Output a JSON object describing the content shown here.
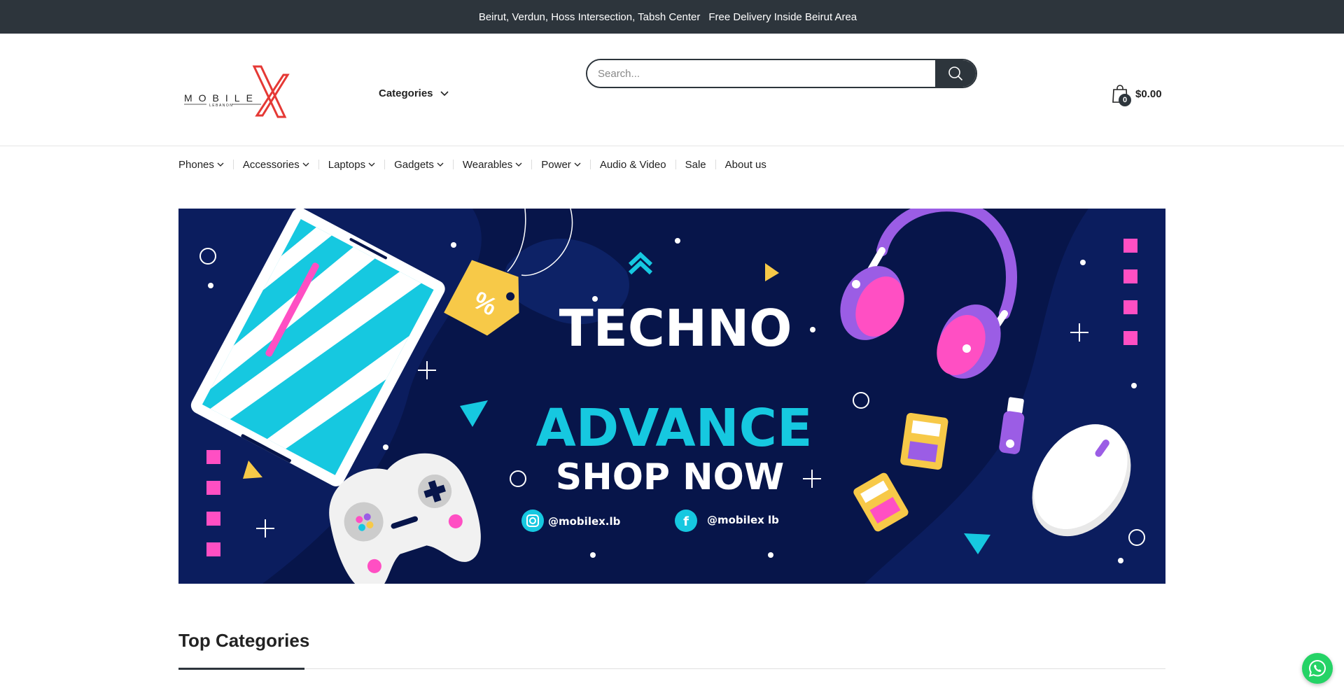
{
  "topbar": {
    "address": "Beirut, Verdun, Hoss Intersection, Tabsh Center",
    "separator": "",
    "delivery": "Free Delivery Inside Beirut Area",
    "trailing": ""
  },
  "header": {
    "logo": {
      "brand": "MOBILE X",
      "sub": "LEBANON",
      "accent_color": "#e53935"
    },
    "categories_label": "Categories",
    "search_placeholder": "Search...",
    "cart": {
      "count": "0",
      "total": "$0.00"
    }
  },
  "nav": {
    "items": [
      {
        "label": "Phones",
        "has_dropdown": true
      },
      {
        "label": "Accessories",
        "has_dropdown": true
      },
      {
        "label": "Laptops",
        "has_dropdown": true
      },
      {
        "label": "Gadgets",
        "has_dropdown": true
      },
      {
        "label": "Wearables",
        "has_dropdown": true
      },
      {
        "label": "Power",
        "has_dropdown": true
      },
      {
        "label": "Audio & Video",
        "has_dropdown": false
      },
      {
        "label": "Sale",
        "has_dropdown": false
      },
      {
        "label": "About us",
        "has_dropdown": false
      }
    ]
  },
  "hero": {
    "line1": "TECHNO",
    "line2": "ADVANCE",
    "line3": "SHOP NOW",
    "instagram": "@mobilex.lb",
    "facebook": "@mobilex lb",
    "percent_tag": "%",
    "colors": {
      "background": "#07154a",
      "cyan": "#16c8e0",
      "pink": "#ff4fc3",
      "yellow": "#f7c948",
      "purple": "#9b5de5"
    }
  },
  "top_categories": {
    "title": "Top Categories"
  },
  "colors": {
    "dark": "#2d353c",
    "whatsapp": "#25d366"
  }
}
